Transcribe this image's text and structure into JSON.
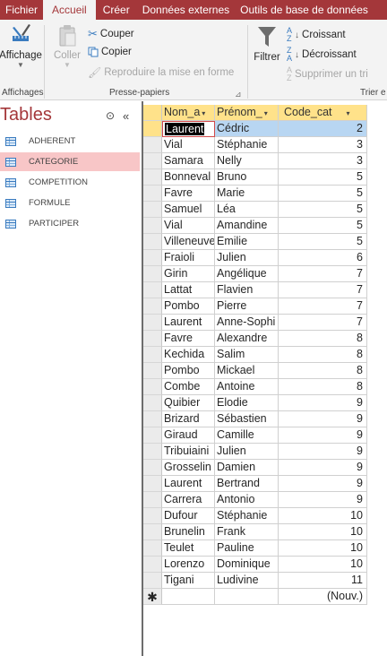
{
  "ribbon": {
    "tabs": [
      "Fichier",
      "Accueil",
      "Créer",
      "Données externes",
      "Outils de base de données"
    ],
    "view_group": {
      "button": "Affichage",
      "label": "Affichages"
    },
    "clipboard_group": {
      "paste": "Coller",
      "cut": "Couper",
      "copy": "Copier",
      "format_painter": "Reproduire la mise en forme",
      "label": "Presse-papiers"
    },
    "sort_group": {
      "filter": "Filtrer",
      "ascending": "Croissant",
      "descending": "Décroissant",
      "remove_sort": "Supprimer un tri",
      "label": "Trier e"
    }
  },
  "nav": {
    "title": "Tables",
    "items": [
      "ADHERENT",
      "CATEGORIE",
      "COMPETITION",
      "FORMULE",
      "PARTICIPER"
    ],
    "selected_index": 1
  },
  "datasheet": {
    "headers": [
      "Nom_a",
      "Prénom_",
      "Code_cat"
    ],
    "rows": [
      [
        "Laurent",
        "Cédric",
        "2"
      ],
      [
        "Vial",
        "Stéphanie",
        "3"
      ],
      [
        "Samara",
        "Nelly",
        "3"
      ],
      [
        "Bonneval",
        "Bruno",
        "5"
      ],
      [
        "Favre",
        "Marie",
        "5"
      ],
      [
        "Samuel",
        "Léa",
        "5"
      ],
      [
        "Vial",
        "Amandine",
        "5"
      ],
      [
        "Villeneuve",
        "Emilie",
        "5"
      ],
      [
        "Fraioli",
        "Julien",
        "6"
      ],
      [
        "Girin",
        "Angélique",
        "7"
      ],
      [
        "Lattat",
        "Flavien",
        "7"
      ],
      [
        "Pombo",
        "Pierre",
        "7"
      ],
      [
        "Laurent",
        "Anne-Sophi",
        "7"
      ],
      [
        "Favre",
        "Alexandre",
        "8"
      ],
      [
        "Kechida",
        "Salim",
        "8"
      ],
      [
        "Pombo",
        "Mickael",
        "8"
      ],
      [
        "Combe",
        "Antoine",
        "8"
      ],
      [
        "Quibier",
        "Elodie",
        "9"
      ],
      [
        "Brizard",
        "Sébastien",
        "9"
      ],
      [
        "Giraud",
        "Camille",
        "9"
      ],
      [
        "Tribuiaini",
        "Julien",
        "9"
      ],
      [
        "Grosselin",
        "Damien",
        "9"
      ],
      [
        "Laurent",
        "Bertrand",
        "9"
      ],
      [
        "Carrera",
        "Antonio",
        "9"
      ],
      [
        "Dufour",
        "Stéphanie",
        "10"
      ],
      [
        "Brunelin",
        "Frank",
        "10"
      ],
      [
        "Teulet",
        "Pauline",
        "10"
      ],
      [
        "Lorenzo",
        "Dominique",
        "10"
      ],
      [
        "Tigani",
        "Ludivine",
        "11"
      ]
    ],
    "new_row_marker": "✱",
    "new_row_label": "(Nouv.)"
  },
  "colors": {
    "accent": "#a4373a",
    "header": "#ffe28a",
    "selection": "#b8d6f2",
    "nav_selected": "#f8c6c7"
  },
  "icons": {
    "view": "ruler-pencil-icon",
    "paste": "clipboard-icon",
    "cut": "scissors-icon",
    "copy": "copy-icon",
    "format_painter": "paintbrush-icon",
    "filter": "funnel-icon",
    "sort_asc": "sort-ascending-icon",
    "sort_desc": "sort-descending-icon",
    "remove_sort": "remove-sort-icon"
  }
}
